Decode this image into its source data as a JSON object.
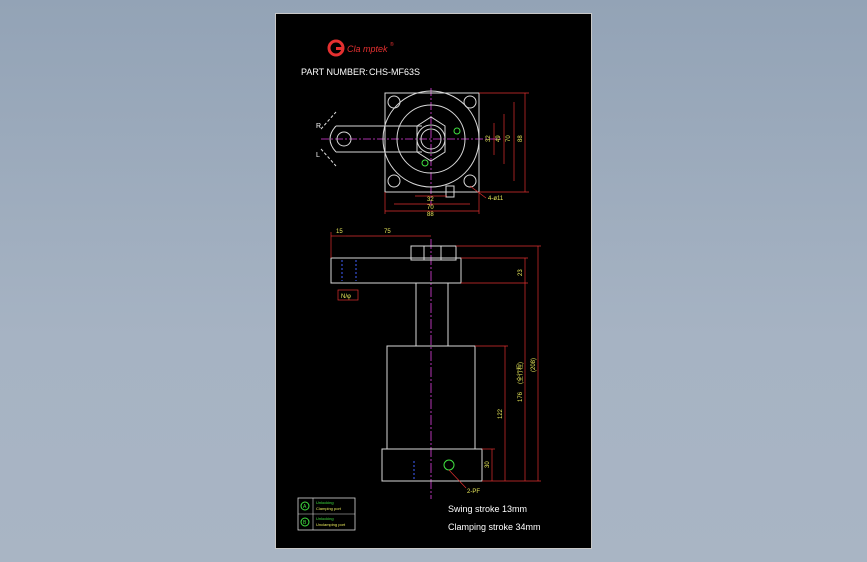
{
  "brand": {
    "name": "Cla mptek",
    "mark": "®",
    "color": "#e53030"
  },
  "part": {
    "label": "PART NUMBER:",
    "value": "CHS-MF63S"
  },
  "top_view": {
    "side_labels": {
      "right": "R",
      "left": "L"
    },
    "dims": {
      "d32v": "32",
      "d49v": "49",
      "d70v": "70",
      "d88v": "88",
      "d32h": "32",
      "d70h": "70",
      "d88h": "88",
      "holes": "4-ø11"
    }
  },
  "side_view": {
    "dims": {
      "d15": "15",
      "d75": "75",
      "d23": "23",
      "d122": "122",
      "d176": "176",
      "d176_note": "(全行程)",
      "d30": "30",
      "d208": "(208)",
      "ports": "2-PF",
      "nut": "N/φ"
    }
  },
  "legend": [
    {
      "marker": "A",
      "text1": "Unlocking",
      "text2": "Clamping port"
    },
    {
      "marker": "B",
      "text1": "Unlocking",
      "text2": "Unclamping port"
    }
  ],
  "notes": {
    "swing": "Swing stroke 13mm",
    "clamping": "Clamping stroke 34mm"
  },
  "colors": {
    "outline": "#d8d8d8",
    "center": "#e040e0",
    "dim": "#e03030",
    "dimtext": "#e8e85a",
    "note": "#ffffff",
    "accent": "#40e040",
    "blue": "#4060ff"
  }
}
